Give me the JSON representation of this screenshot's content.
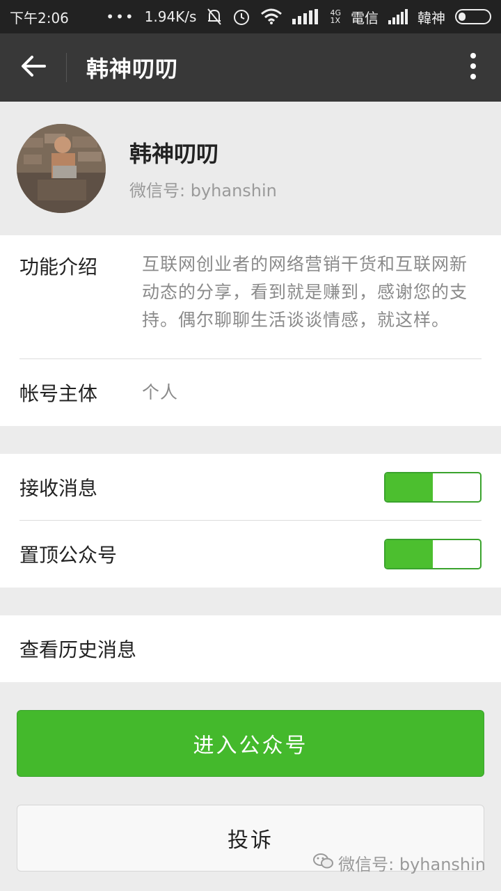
{
  "status_bar": {
    "time": "下午2:06",
    "dots": "•••",
    "speed": "1.94K/s",
    "network_type_top": "4G",
    "network_type_bottom": "1X",
    "carrier": "電信",
    "carrier2": "韓神"
  },
  "nav": {
    "title": "韩神叨叨"
  },
  "profile": {
    "name": "韩神叨叨",
    "wechat_id": "微信号: byhanshin"
  },
  "info": {
    "intro_label": "功能介绍",
    "intro_value": "互联网创业者的网络营销干货和互联网新动态的分享，看到就是赚到，感谢您的支持。偶尔聊聊生活谈谈情感，就这样。",
    "owner_label": "帐号主体",
    "owner_value": "个人"
  },
  "settings": {
    "receive_label": "接收消息",
    "receive_on": true,
    "pin_label": "置顶公众号",
    "pin_on": true
  },
  "history": {
    "label": "查看历史消息"
  },
  "buttons": {
    "enter_label": "进入公众号",
    "report_label": "投诉"
  },
  "watermark": {
    "text": "微信号: byhanshin"
  },
  "colors": {
    "accent_green": "#44b92c",
    "nav_bg": "#383838",
    "status_bg": "#222222"
  }
}
